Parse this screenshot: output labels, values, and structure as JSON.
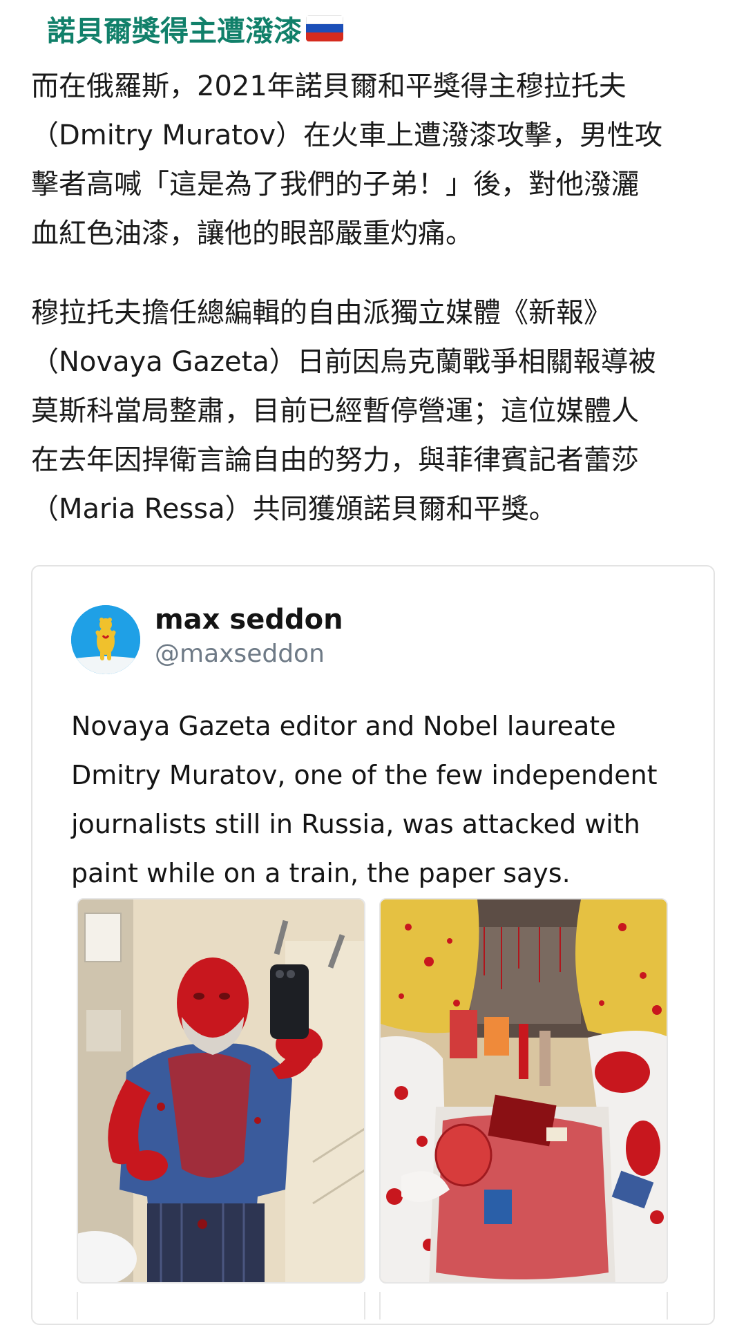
{
  "headline": {
    "text": "諾貝爾獎得主遭潑漆",
    "flag_icon": "russia-flag-icon"
  },
  "paragraph1": {
    "lines": [
      "而在俄羅斯，2021年諾貝爾和平獎得主穆拉托夫",
      "（Dmitry Muratov）在火車上遭潑漆攻擊，男性攻",
      "擊者高喊「這是為了我們的子弟！」後，對他潑灑",
      "血紅色油漆，讓他的眼部嚴重灼痛。"
    ]
  },
  "paragraph2": {
    "lines": [
      "穆拉托夫擔任總編輯的自由派獨立媒體《新報》",
      "（Novaya Gazeta）日前因烏克蘭戰爭相關報導被",
      "莫斯科當局整肅，目前已經暫停營運；這位媒體人",
      "在去年因捍衛言論自由的努力，與菲律賓記者蕾莎",
      "（Maria Ressa）共同獲頒諾貝爾和平獎。"
    ]
  },
  "tweet": {
    "author_name": "max seddon",
    "author_handle": "@maxseddon",
    "avatar_icon": "bear-avatar-icon",
    "text_lines": [
      "Novaya Gazeta editor and Nobel laureate",
      "Dmitry Muratov, one of the few independent",
      "journalists still in Russia, was attacked with",
      "paint while on a train, the paper says."
    ],
    "media": [
      {
        "icon": "photo-man-covered-in-red-paint"
      },
      {
        "icon": "photo-train-compartment-splattered-with-paint"
      }
    ]
  },
  "colors": {
    "headline_green": "#11806a",
    "handle_gray": "#6e7a86",
    "paint_red": "#c8171e",
    "avatar_blue": "#1fa0e6"
  }
}
